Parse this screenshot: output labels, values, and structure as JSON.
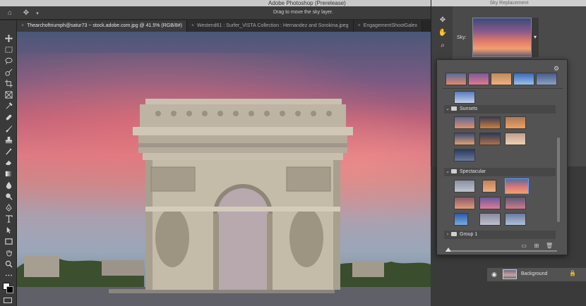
{
  "app": {
    "title": "Adobe Photoshop (Prerelease)",
    "options_hint": "Drag to move the sky layer."
  },
  "tabs": [
    {
      "label": "Thearchoftriumph@satur73 ~ stock.adobe.com.jpg @ 41.5% (RGB/8#)",
      "active": true
    },
    {
      "label": "Westend61 : Surfer_VISTA Collection : Hernandez and Sorokina.jpeg",
      "active": false
    },
    {
      "label": "EngagementShootGalex",
      "active": false
    }
  ],
  "tools": [
    "move-icon",
    "marquee-icon",
    "lasso-icon",
    "quick-select-icon",
    "crop-icon",
    "frame-icon",
    "eyedropper-icon",
    "healing-icon",
    "brush-icon",
    "stamp-icon",
    "history-brush-icon",
    "eraser-icon",
    "gradient-icon",
    "blur-icon",
    "dodge-icon",
    "pen-icon",
    "type-icon",
    "path-select-icon",
    "rectangle-icon",
    "hand-icon",
    "zoom-icon"
  ],
  "sky_dialog": {
    "title": "Sky Replacement",
    "sky_label": "Sky:"
  },
  "picker": {
    "groups": [
      {
        "name": "Sunsets",
        "expanded": true
      },
      {
        "name": "Spectacular",
        "expanded": true
      },
      {
        "name": "Group 1",
        "expanded": false
      }
    ],
    "colors": {
      "selection": "#5fa0ff"
    }
  },
  "layers": {
    "background": "Background"
  }
}
